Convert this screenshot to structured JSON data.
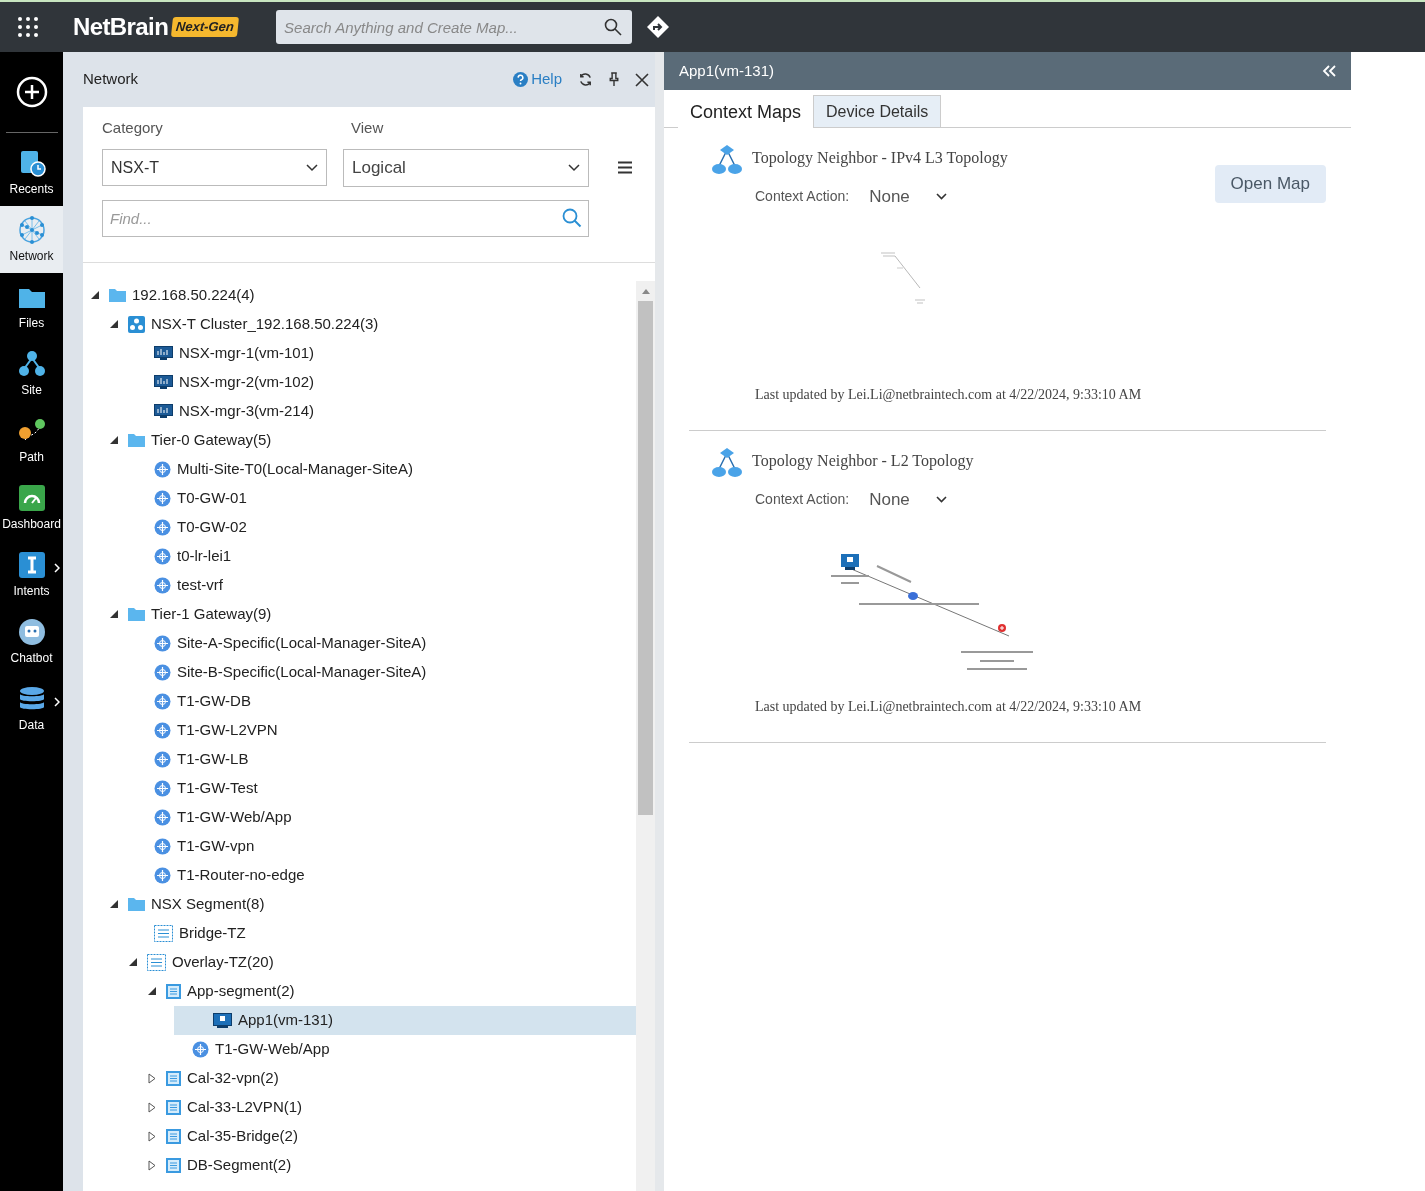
{
  "top_bar": {
    "logo": "NetBrain",
    "badge": "Next-Gen",
    "search": {
      "placeholder": "Search Anything and Create Map..."
    }
  },
  "nav_rail": [
    {
      "label": "Recents",
      "kind": "recents",
      "selected": false,
      "has_flyout": false
    },
    {
      "label": "Network",
      "kind": "network",
      "selected": true,
      "has_flyout": false
    },
    {
      "label": "Files",
      "kind": "files",
      "selected": false,
      "has_flyout": false
    },
    {
      "label": "Site",
      "kind": "site",
      "selected": false,
      "has_flyout": false
    },
    {
      "label": "Path",
      "kind": "path",
      "selected": false,
      "has_flyout": false
    },
    {
      "label": "Dashboard",
      "kind": "dashboard",
      "selected": false,
      "has_flyout": false
    },
    {
      "label": "Intents",
      "kind": "intents",
      "selected": false,
      "has_flyout": true
    },
    {
      "label": "Chatbot",
      "kind": "chatbot",
      "selected": false,
      "has_flyout": false
    },
    {
      "label": "Data",
      "kind": "data",
      "selected": false,
      "has_flyout": true
    }
  ],
  "network_panel": {
    "title": "Network",
    "help": "Help",
    "category": {
      "label": "Category",
      "value": "NSX-T"
    },
    "view": {
      "label": "View",
      "value": "Logical"
    },
    "find": {
      "placeholder": "Find..."
    },
    "tree": [
      {
        "label": "192.168.50.224(4)",
        "kind": "folder",
        "expanded": true,
        "selected": false,
        "children": [
          {
            "label": "NSX-T Cluster_192.168.50.224(3)",
            "kind": "cluster",
            "expanded": true,
            "selected": false,
            "children": [
              {
                "label": "NSX-mgr-1(vm-101)",
                "kind": "server",
                "selected": false
              },
              {
                "label": "NSX-mgr-2(vm-102)",
                "kind": "server",
                "selected": false
              },
              {
                "label": "NSX-mgr-3(vm-214)",
                "kind": "server",
                "selected": false
              }
            ]
          },
          {
            "label": "Tier-0 Gateway(5)",
            "kind": "folder",
            "expanded": true,
            "selected": false,
            "children": [
              {
                "label": "Multi-Site-T0(Local-Manager-SiteA)",
                "kind": "router",
                "selected": false
              },
              {
                "label": "T0-GW-01",
                "kind": "router",
                "selected": false
              },
              {
                "label": "T0-GW-02",
                "kind": "router",
                "selected": false
              },
              {
                "label": "t0-lr-lei1",
                "kind": "router",
                "selected": false
              },
              {
                "label": "test-vrf",
                "kind": "router",
                "selected": false
              }
            ]
          },
          {
            "label": "Tier-1 Gateway(9)",
            "kind": "folder",
            "expanded": true,
            "selected": false,
            "children": [
              {
                "label": "Site-A-Specific(Local-Manager-SiteA)",
                "kind": "router",
                "selected": false
              },
              {
                "label": "Site-B-Specific(Local-Manager-SiteA)",
                "kind": "router",
                "selected": false
              },
              {
                "label": "T1-GW-DB",
                "kind": "router",
                "selected": false
              },
              {
                "label": "T1-GW-L2VPN",
                "kind": "router",
                "selected": false
              },
              {
                "label": "T1-GW-LB",
                "kind": "router",
                "selected": false
              },
              {
                "label": "T1-GW-Test",
                "kind": "router",
                "selected": false
              },
              {
                "label": "T1-GW-Web/App",
                "kind": "router",
                "selected": false
              },
              {
                "label": "T1-GW-vpn",
                "kind": "router",
                "selected": false
              },
              {
                "label": "T1-Router-no-edge",
                "kind": "router",
                "selected": false
              }
            ]
          },
          {
            "label": "NSX Segment(8)",
            "kind": "folder",
            "expanded": true,
            "selected": false,
            "children": [
              {
                "label": "Bridge-TZ",
                "kind": "zone",
                "selected": false
              },
              {
                "label": "Overlay-TZ(20)",
                "kind": "zone",
                "expanded": true,
                "selected": false,
                "children": [
                  {
                    "label": "App-segment(2)",
                    "kind": "segment",
                    "expanded": true,
                    "selected": false,
                    "children": [
                      {
                        "label": "App1(vm-131)",
                        "kind": "vm",
                        "selected": true
                      },
                      {
                        "label": "T1-GW-Web/App",
                        "kind": "router",
                        "selected": false
                      }
                    ]
                  },
                  {
                    "label": "Cal-32-vpn(2)",
                    "kind": "segment",
                    "expanded": false,
                    "selected": false
                  },
                  {
                    "label": "Cal-33-L2VPN(1)",
                    "kind": "segment",
                    "expanded": false,
                    "selected": false
                  },
                  {
                    "label": "Cal-35-Bridge(2)",
                    "kind": "segment",
                    "expanded": false,
                    "selected": false
                  },
                  {
                    "label": "DB-Segment(2)",
                    "kind": "segment",
                    "expanded": false,
                    "selected": false
                  }
                ]
              }
            ]
          }
        ]
      }
    ]
  },
  "detail_panel": {
    "title": "App1(vm-131)",
    "tabs": [
      {
        "label": "Context Maps",
        "selected": true
      },
      {
        "label": "Device Details",
        "selected": false
      }
    ],
    "maps": [
      {
        "title": "Topology Neighbor - IPv4 L3 Topology",
        "context_label": "Context Action:",
        "context_value": "None",
        "open_button": "Open Map",
        "kind": "l3",
        "updated": "Last updated by Lei.Li@netbraintech.com at 4/22/2024, 9:33:10 AM"
      },
      {
        "title": "Topology Neighbor - L2 Topology",
        "context_label": "Context Action:",
        "context_value": "None",
        "kind": "l2",
        "updated": "Last updated by Lei.Li@netbraintech.com at 4/22/2024, 9:33:10 AM"
      }
    ]
  }
}
